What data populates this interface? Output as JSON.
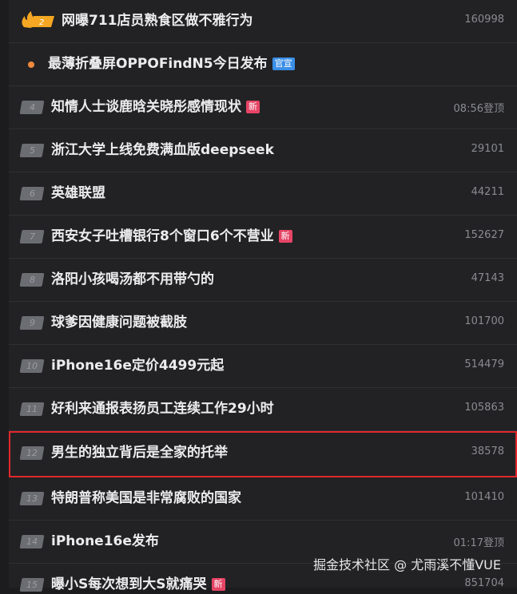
{
  "hot_list": [
    {
      "rank": "",
      "title": "网曝711店员熟食区做不雅行为",
      "tag": "",
      "count": "160998"
    },
    {
      "rank": "",
      "title": "最薄折叠屏OPPOFindN5今日发布",
      "tag": "官宣",
      "count": ""
    },
    {
      "rank": "4",
      "title": "知情人士谈鹿晗关晓彤感情现状",
      "tag": "新",
      "count": "08:56登顶"
    },
    {
      "rank": "5",
      "title": "浙江大学上线免费满血版deepseek",
      "tag": "",
      "count": "29101"
    },
    {
      "rank": "6",
      "title": "英雄联盟",
      "tag": "",
      "count": "44211"
    },
    {
      "rank": "7",
      "title": "西安女子吐槽银行8个窗口6个不营业",
      "tag": "新",
      "count": "152627"
    },
    {
      "rank": "8",
      "title": "洛阳小孩喝汤都不用带勺的",
      "tag": "",
      "count": "47143"
    },
    {
      "rank": "9",
      "title": "球爹因健康问题被截肢",
      "tag": "",
      "count": "101700"
    },
    {
      "rank": "10",
      "title": "iPhone16e定价4499元起",
      "tag": "",
      "count": "514479"
    },
    {
      "rank": "11",
      "title": "好利来通报表扬员工连续工作29小时",
      "tag": "",
      "count": "105863"
    },
    {
      "rank": "12",
      "title": "男生的独立背后是全家的托举",
      "tag": "",
      "count": "38578"
    },
    {
      "rank": "13",
      "title": "特朗普称美国是非常腐败的国家",
      "tag": "",
      "count": "101410"
    },
    {
      "rank": "14",
      "title": "iPhone16e发布",
      "tag": "",
      "count": "01:17登顶"
    },
    {
      "rank": "15",
      "title": "曝小S每次想到大S就痛哭",
      "tag": "新",
      "count": "851704"
    }
  ],
  "watermark": "掘金技术社区 @ 尤雨溪不懂VUE",
  "colors": {
    "background": "#222224",
    "highlight_border": "#e0282d",
    "new_tag": "#e64566",
    "official_tag": "#3a8ee6",
    "hot_icon": "#f5a623"
  }
}
